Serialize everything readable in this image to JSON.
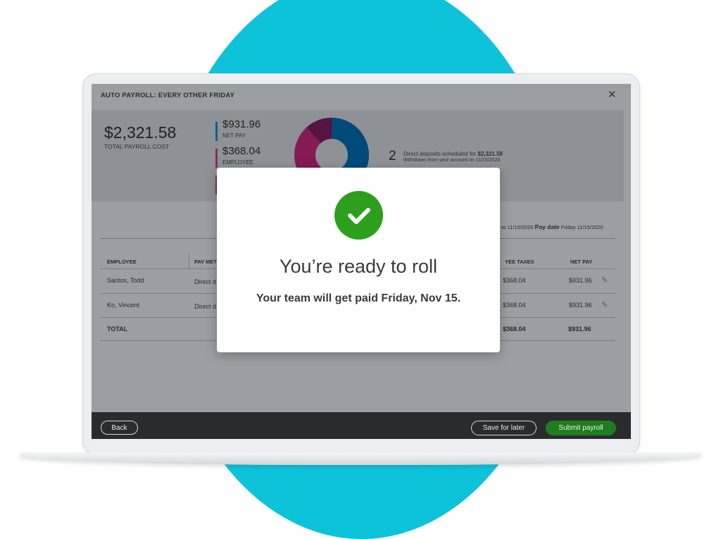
{
  "colors": {
    "circle": "#0cc3da",
    "net_pay": "#0077c5",
    "employee": "#d52b8b",
    "other": "#8d1e6b",
    "submit": "#2ca01c",
    "check": "#2ca01c"
  },
  "window": {
    "title": "AUTO PAYROLL: EVERY OTHER FRIDAY",
    "close_icon": "close-icon"
  },
  "summary": {
    "total_amount": "$2,321.58",
    "total_label": "TOTAL PAYROLL COST",
    "legend": [
      {
        "amount": "$931.96",
        "label": "NET PAY",
        "color": "#0077c5"
      },
      {
        "amount": "$368.04",
        "label": "EMPLOYEE",
        "color": "#d52b8b"
      },
      {
        "amount": "",
        "label": "",
        "color": "#d52b8b"
      }
    ],
    "donut": [
      {
        "name": "net pay",
        "fraction": 0.4,
        "color": "#0077c5"
      },
      {
        "name": "employee",
        "fraction": 0.16,
        "color": "#1a8fd6"
      },
      {
        "name": "employer",
        "fraction": 0.32,
        "color": "#d52b8b"
      },
      {
        "name": "other",
        "fraction": 0.12,
        "color": "#8d1e6b"
      }
    ],
    "deposits": {
      "count": "2",
      "text_prefix": "Direct deposits scheduled for ",
      "amount": "$2,321.58",
      "withdrawn": "Withdrawn from your account on 11/15/2020"
    }
  },
  "period": {
    "range_text": "0 to 11/15/2020",
    "pay_date_label": "Pay date",
    "pay_date_value": "Friday 11/15/2020"
  },
  "table": {
    "headers": {
      "employee": "EMPLOYEE",
      "pay_method": "PAY MET",
      "taxes": "YEE TAXES",
      "net_pay": "NET PAY"
    },
    "rows": [
      {
        "employee": "Santos, Todd",
        "pay_method": "Direct d",
        "taxes": "$368.04",
        "net_pay": "$931.96"
      },
      {
        "employee": "Ko, Vincent",
        "pay_method": "Direct d",
        "taxes": "$368.04",
        "net_pay": "$931.96"
      }
    ],
    "total": {
      "label": "TOTAL",
      "taxes": "$368.04",
      "net_pay": "$931.96"
    }
  },
  "footer": {
    "back": "Back",
    "save": "Save for later",
    "submit": "Submit payroll"
  },
  "modal": {
    "icon": "checkmark-icon",
    "title": "You’re ready to roll",
    "subtitle": "Your team will get paid Friday, Nov 15."
  }
}
